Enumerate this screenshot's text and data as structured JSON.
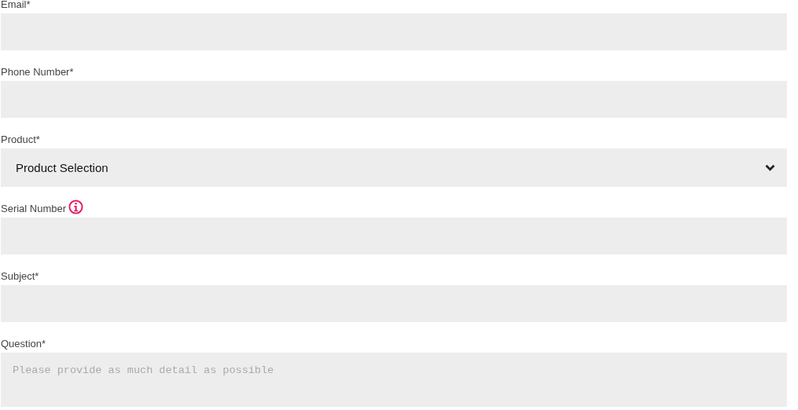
{
  "fields": [
    {
      "kind": "text",
      "label": "Email*",
      "info": false
    },
    {
      "kind": "text",
      "label": "Phone Number*",
      "info": false
    },
    {
      "kind": "select",
      "label": "Product*",
      "info": false,
      "value": "Product Selection"
    },
    {
      "kind": "text",
      "label": "Serial Number",
      "info": true
    },
    {
      "kind": "text",
      "label": "Subject*",
      "info": false
    },
    {
      "kind": "textarea",
      "label": "Question*",
      "info": false,
      "placeholder": "Please provide as much detail as possible"
    }
  ]
}
